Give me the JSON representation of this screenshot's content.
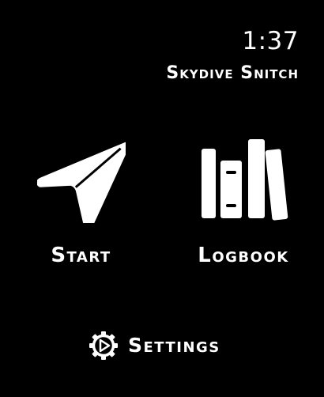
{
  "status": {
    "time": "1:37"
  },
  "app": {
    "title": "Skydive Snitch"
  },
  "menu": {
    "start": {
      "label": "Start",
      "icon": "paper-plane-icon"
    },
    "logbook": {
      "label": "Logbook",
      "icon": "books-icon"
    }
  },
  "settings": {
    "label": "Settings",
    "icon": "gear-play-icon"
  },
  "colors": {
    "background": "#000000",
    "foreground": "#ffffff"
  }
}
